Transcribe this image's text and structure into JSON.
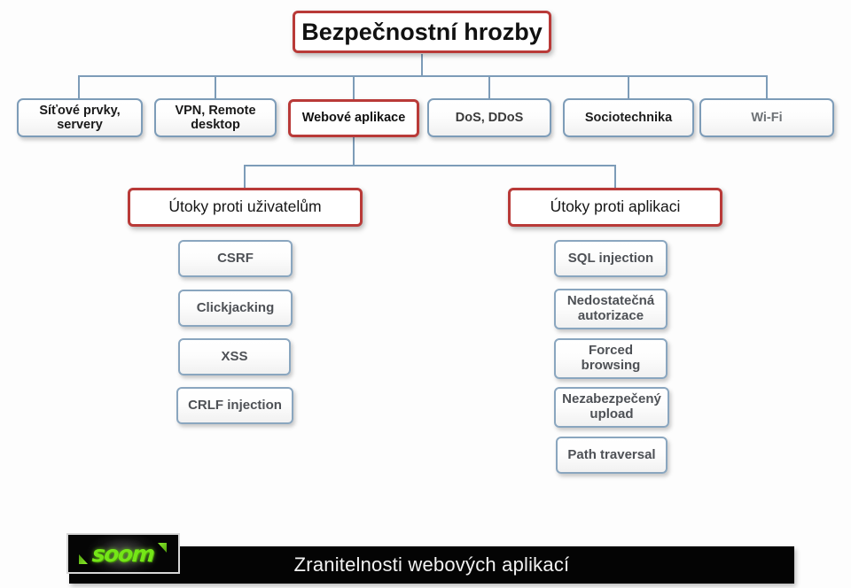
{
  "diagram": {
    "type": "tree",
    "root": {
      "label": "Bezpečnostní hrozby",
      "style": "red"
    },
    "level2": [
      {
        "label": "Síťové prvky,\nservery",
        "style": "blue"
      },
      {
        "label": "VPN, Remote\ndesktop",
        "style": "blue"
      },
      {
        "label": "Webové aplikace",
        "style": "red"
      },
      {
        "label": "DoS, DDoS",
        "style": "blue"
      },
      {
        "label": "Sociotechnika",
        "style": "blue"
      },
      {
        "label": "Wi-Fi",
        "style": "blue"
      }
    ],
    "level3": [
      {
        "label": "Útoky proti uživatelům",
        "style": "red"
      },
      {
        "label": "Útoky proti aplikaci",
        "style": "red"
      }
    ],
    "user_attacks": [
      {
        "label": "CSRF"
      },
      {
        "label": "Clickjacking"
      },
      {
        "label": "XSS"
      },
      {
        "label": "CRLF injection"
      }
    ],
    "app_attacks": [
      {
        "label": "SQL injection"
      },
      {
        "label": "Nedostatečná\nautorizace"
      },
      {
        "label": "Forced\nbrowsing"
      },
      {
        "label": "Nezabezpečený\nupload"
      },
      {
        "label": "Path traversal"
      }
    ]
  },
  "footer": {
    "title": "Zranitelnosti webových aplikací",
    "logo_text": "soom"
  },
  "colors": {
    "accent_red": "#b93a38",
    "connector_blue": "#7d9cb8",
    "box_border": "#7d9cb8",
    "footer_bg": "#040404",
    "logo_green": "#74e617"
  }
}
